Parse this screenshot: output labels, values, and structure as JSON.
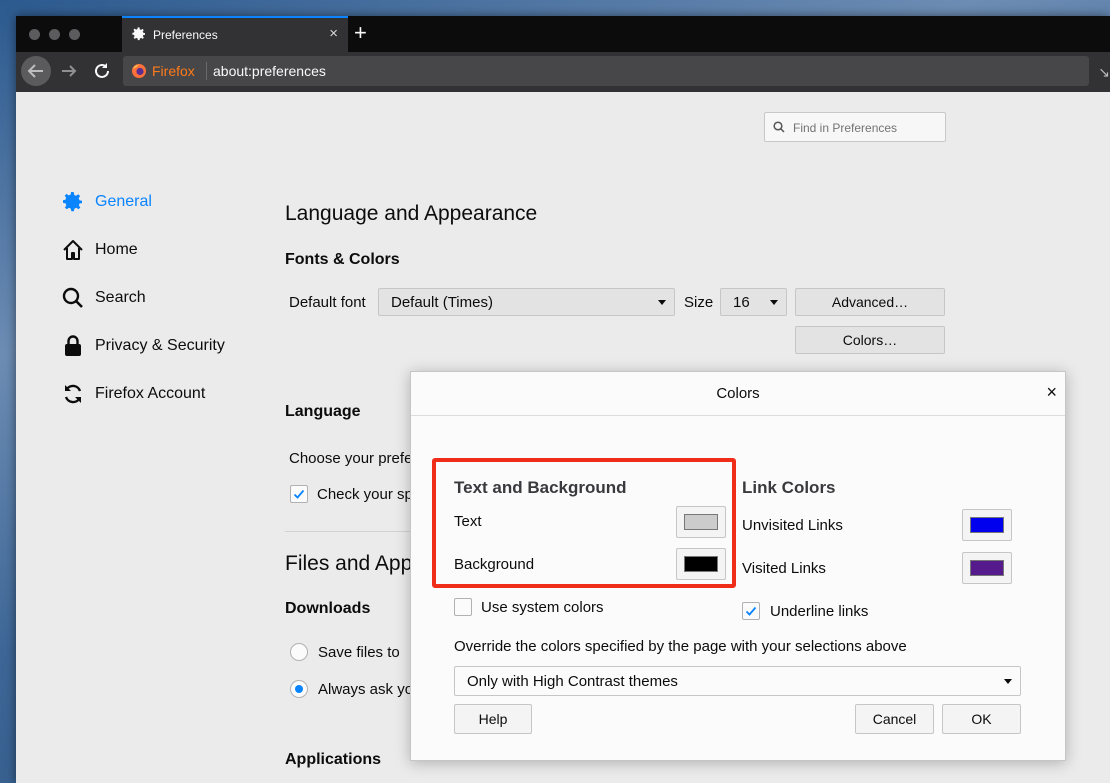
{
  "browser": {
    "tab_title": "Preferences",
    "identity_label": "Firefox",
    "url": "about:preferences",
    "new_tab_symbol": "+",
    "tab_close_symbol": "×"
  },
  "sidebar": {
    "items": [
      {
        "label": "General",
        "icon": "gear-icon",
        "selected": true
      },
      {
        "label": "Home",
        "icon": "home-icon"
      },
      {
        "label": "Search",
        "icon": "search-icon"
      },
      {
        "label": "Privacy & Security",
        "icon": "lock-icon"
      },
      {
        "label": "Firefox Account",
        "icon": "sync-icon"
      }
    ]
  },
  "search": {
    "placeholder": "Find in Preferences"
  },
  "main": {
    "section_language_appearance": "Language and Appearance",
    "fonts_colors_heading": "Fonts & Colors",
    "default_font_label": "Default font",
    "default_font_value": "Default (Times)",
    "size_label": "Size",
    "size_value": "16",
    "advanced_button": "Advanced…",
    "colors_button": "Colors…",
    "language_heading": "Language",
    "language_text": "Choose your prefe",
    "check_spelling_text": "Check your sp",
    "files_apps_heading": "Files and App",
    "downloads_heading": "Downloads",
    "save_files_text": "Save files to",
    "always_ask_text": "Always ask yo",
    "applications_heading": "Applications"
  },
  "dialog": {
    "title": "Colors",
    "close_symbol": "×",
    "text_bg_heading": "Text and Background",
    "text_label": "Text",
    "text_color": "#cccccc",
    "background_label": "Background",
    "background_color": "#000000",
    "use_system_colors": "Use system colors",
    "use_system_colors_checked": false,
    "link_colors_heading": "Link Colors",
    "unvisited_label": "Unvisited Links",
    "unvisited_color": "#0000ee",
    "visited_label": "Visited Links",
    "visited_color": "#551a8b",
    "underline_links": "Underline links",
    "underline_links_checked": true,
    "override_text": "Override the colors specified by the page with your selections above",
    "override_value": "Only with High Contrast themes",
    "help_button": "Help",
    "cancel_button": "Cancel",
    "ok_button": "OK",
    "highlight_color": "#f02d18"
  }
}
